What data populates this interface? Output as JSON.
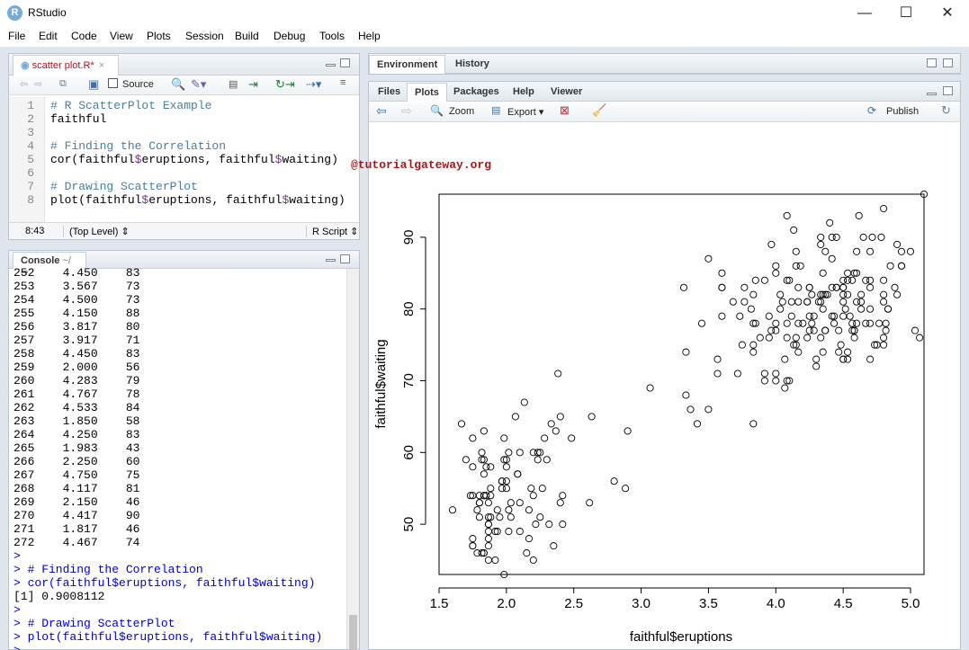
{
  "app": {
    "title": "RStudio",
    "logo": "R"
  },
  "window_controls": {
    "minimize": "—",
    "maximize": "☐",
    "close": "✕"
  },
  "menu": [
    "File",
    "Edit",
    "Code",
    "View",
    "Plots",
    "Session",
    "Build",
    "Debug",
    "Tools",
    "Help"
  ],
  "editor": {
    "tab_label": "scatter plot.R*",
    "source_label": "Source",
    "lines": [
      {
        "n": "1",
        "text": "# R ScatterPlot Example",
        "kind": "comment"
      },
      {
        "n": "2",
        "text": "faithful",
        "kind": "code"
      },
      {
        "n": "3",
        "text": "",
        "kind": "code"
      },
      {
        "n": "4",
        "text": "# Finding the Correlation",
        "kind": "comment"
      },
      {
        "n": "5",
        "text": "cor(faithful$eruptions, faithful$waiting)",
        "kind": "code"
      },
      {
        "n": "6",
        "text": "",
        "kind": "code"
      },
      {
        "n": "7",
        "text": "# Drawing ScatterPlot",
        "kind": "comment"
      },
      {
        "n": "8",
        "text": "plot(faithful$eruptions, faithful$waiting)",
        "kind": "code"
      }
    ],
    "status_position": "8:43",
    "status_scope": "(Top Level) ⇕",
    "status_type": "R Script ⇕"
  },
  "console": {
    "tab_label": "Console",
    "path": "~/",
    "lines": [
      "252    4.450    83",
      "253    3.567    73",
      "254    4.500    73",
      "255    4.150    88",
      "256    3.817    80",
      "257    3.917    71",
      "258    4.450    83",
      "259    2.000    56",
      "260    4.283    79",
      "261    4.767    78",
      "262    4.533    84",
      "263    1.850    58",
      "264    4.250    83",
      "265    1.983    43",
      "266    2.250    60",
      "267    4.750    75",
      "268    4.117    81",
      "269    2.150    46",
      "270    4.417    90",
      "271    1.817    46",
      "272    4.467    74",
      "> ",
      "> # Finding the Correlation",
      "> cor(faithful$eruptions, faithful$waiting)",
      "[1] 0.9008112",
      "> ",
      "> # Drawing ScatterPlot",
      "> plot(faithful$eruptions, faithful$waiting)",
      "> "
    ]
  },
  "env_tabs": [
    "Environment",
    "History"
  ],
  "plot_tabs": [
    "Files",
    "Plots",
    "Packages",
    "Help",
    "Viewer"
  ],
  "plot_toolbar": {
    "zoom": "Zoom",
    "export": "Export ▾",
    "publish": "Publish"
  },
  "watermark": "@tutorialgateway.org",
  "icons": {
    "back": "arrow-left-icon",
    "forward": "arrow-right-icon",
    "zoom": "magnifier-icon",
    "export": "export-icon",
    "remove": "remove-plot-icon",
    "clear": "broom-icon",
    "publish": "publish-icon",
    "refresh": "refresh-icon"
  },
  "chart_data": {
    "type": "scatter",
    "xlabel": "faithful$eruptions",
    "ylabel": "faithful$waiting",
    "xlim": [
      1.5,
      5.1
    ],
    "ylim": [
      43,
      96
    ],
    "xticks": [
      1.5,
      2.0,
      2.5,
      3.0,
      3.5,
      4.0,
      4.5,
      5.0
    ],
    "yticks": [
      50,
      60,
      70,
      80,
      90
    ],
    "x": [
      3.6,
      1.8,
      3.333,
      2.283,
      4.533,
      2.883,
      4.7,
      3.6,
      1.95,
      4.35,
      1.833,
      3.917,
      4.2,
      1.75,
      4.7,
      2.167,
      1.75,
      4.8,
      1.6,
      4.25,
      1.8,
      1.75,
      3.45,
      3.067,
      4.533,
      3.6,
      1.967,
      4.083,
      3.85,
      4.433,
      4.3,
      4.467,
      3.367,
      4.033,
      3.833,
      2.017,
      1.867,
      4.833,
      1.833,
      4.783,
      4.35,
      1.883,
      4.567,
      1.75,
      4.533,
      3.317,
      3.833,
      2.1,
      4.633,
      2.0,
      4.8,
      4.716,
      1.833,
      4.833,
      1.733,
      4.883,
      3.717,
      1.667,
      4.567,
      4.317,
      2.233,
      4.5,
      1.75,
      4.8,
      1.817,
      4.4,
      4.167,
      4.7,
      2.067,
      4.7,
      4.033,
      1.967,
      4.5,
      4.0,
      1.983,
      5.067,
      2.017,
      4.567,
      3.883,
      3.6,
      4.133,
      4.333,
      4.1,
      2.633,
      4.067,
      4.933,
      3.95,
      4.517,
      2.167,
      4.0,
      2.2,
      4.333,
      1.867,
      4.817,
      1.833,
      4.3,
      4.667,
      3.75,
      1.867,
      4.9,
      2.483,
      4.367,
      2.1,
      4.5,
      4.05,
      1.867,
      4.7,
      1.783,
      4.85,
      3.683,
      4.733,
      2.3,
      4.9,
      4.417,
      1.7,
      4.633,
      2.317,
      4.6,
      1.817,
      4.417,
      2.617,
      4.067,
      4.25,
      1.967,
      4.6,
      3.767,
      1.917,
      4.5,
      2.267,
      4.65,
      1.867,
      4.167,
      2.8,
      4.333,
      1.833,
      4.383,
      1.883,
      4.933,
      2.033,
      3.733,
      4.233,
      2.233,
      4.533,
      4.817,
      4.333,
      1.983,
      4.633,
      2.017,
      5.1,
      1.8,
      5.033,
      4.0,
      2.4,
      4.6,
      3.567,
      4.0,
      4.5,
      4.083,
      1.8,
      3.967,
      2.2,
      4.15,
      2.0,
      3.833,
      3.5,
      4.583,
      2.367,
      5.0,
      1.933,
      4.617,
      1.917,
      2.083,
      4.583,
      3.333,
      4.167,
      4.333,
      4.5,
      2.417,
      4.0,
      4.167,
      1.883,
      4.583,
      4.25,
      3.767,
      2.033,
      4.433,
      4.083,
      1.833,
      4.417,
      2.183,
      4.8,
      1.833,
      4.8,
      4.1,
      3.966,
      4.233,
      3.5,
      4.366,
      2.25,
      4.667,
      2.1,
      4.35,
      4.133,
      1.867,
      4.6,
      1.783,
      4.367,
      3.85,
      1.933,
      4.5,
      2.383,
      4.7,
      1.867,
      3.833,
      3.417,
      4.233,
      2.4,
      4.8,
      2.0,
      4.15,
      1.867,
      4.267,
      1.75,
      4.483,
      4.0,
      4.117,
      4.083,
      4.267,
      3.917,
      4.55,
      4.083,
      2.417,
      4.183,
      2.217,
      4.45,
      1.883,
      1.85,
      4.283,
      3.95,
      2.333,
      4.15,
      2.35,
      4.933,
      2.9,
      4.583,
      3.833,
      2.083,
      4.367,
      2.133,
      4.35,
      2.2,
      4.45,
      3.567,
      4.5,
      4.15,
      3.817,
      3.917,
      4.45,
      2.0,
      4.283,
      4.767,
      4.533,
      1.85,
      4.25,
      1.983,
      2.25,
      4.75,
      4.117,
      2.15,
      4.417,
      1.817,
      4.467
    ],
    "y": [
      79,
      54,
      74,
      62,
      85,
      55,
      88,
      85,
      51,
      85,
      54,
      84,
      78,
      47,
      83,
      52,
      62,
      84,
      52,
      79,
      51,
      47,
      78,
      69,
      74,
      83,
      55,
      76,
      78,
      79,
      73,
      77,
      66,
      80,
      74,
      52,
      48,
      80,
      59,
      90,
      80,
      58,
      84,
      58,
      73,
      83,
      64,
      53,
      82,
      59,
      75,
      90,
      54,
      80,
      54,
      83,
      71,
      64,
      77,
      81,
      59,
      84,
      48,
      82,
      60,
      92,
      78,
      78,
      65,
      73,
      82,
      56,
      79,
      71,
      62,
      76,
      60,
      78,
      76,
      83,
      75,
      82,
      70,
      65,
      73,
      88,
      76,
      80,
      48,
      86,
      60,
      90,
      50,
      78,
      63,
      72,
      84,
      75,
      51,
      82,
      62,
      88,
      49,
      83,
      81,
      47,
      84,
      52,
      86,
      81,
      75,
      59,
      89,
      79,
      59,
      81,
      50,
      85,
      59,
      87,
      53,
      69,
      77,
      56,
      88,
      81,
      45,
      82,
      55,
      90,
      45,
      83,
      56,
      89,
      46,
      82,
      51,
      86,
      53,
      79,
      81,
      60,
      82,
      77,
      76,
      59,
      80,
      49,
      96,
      53,
      77,
      77,
      65,
      81,
      71,
      70,
      81,
      93,
      53,
      89,
      45,
      86,
      58,
      78,
      66,
      76,
      63,
      88,
      52,
      93,
      49,
      57,
      77,
      68,
      81,
      81,
      73,
      50,
      85,
      74,
      55,
      77,
      83,
      83,
      51,
      78,
      84,
      46,
      83,
      55,
      81,
      57,
      76,
      84,
      77,
      81,
      87,
      77,
      51,
      78,
      60,
      82,
      91,
      53,
      78,
      46,
      77,
      84,
      49,
      83,
      71,
      80,
      49,
      75,
      64,
      76,
      53,
      94,
      55,
      76,
      50,
      82,
      54,
      75,
      78,
      79,
      78,
      78,
      70,
      79,
      70,
      54,
      86,
      50,
      90,
      54,
      54,
      77,
      79,
      64,
      75,
      47,
      86,
      63,
      85,
      82,
      57,
      82,
      67,
      74,
      54,
      83,
      73,
      73,
      88,
      80,
      71,
      83,
      56,
      79,
      78,
      84,
      58,
      83,
      43,
      60,
      75,
      81,
      46,
      90,
      46,
      74
    ]
  }
}
